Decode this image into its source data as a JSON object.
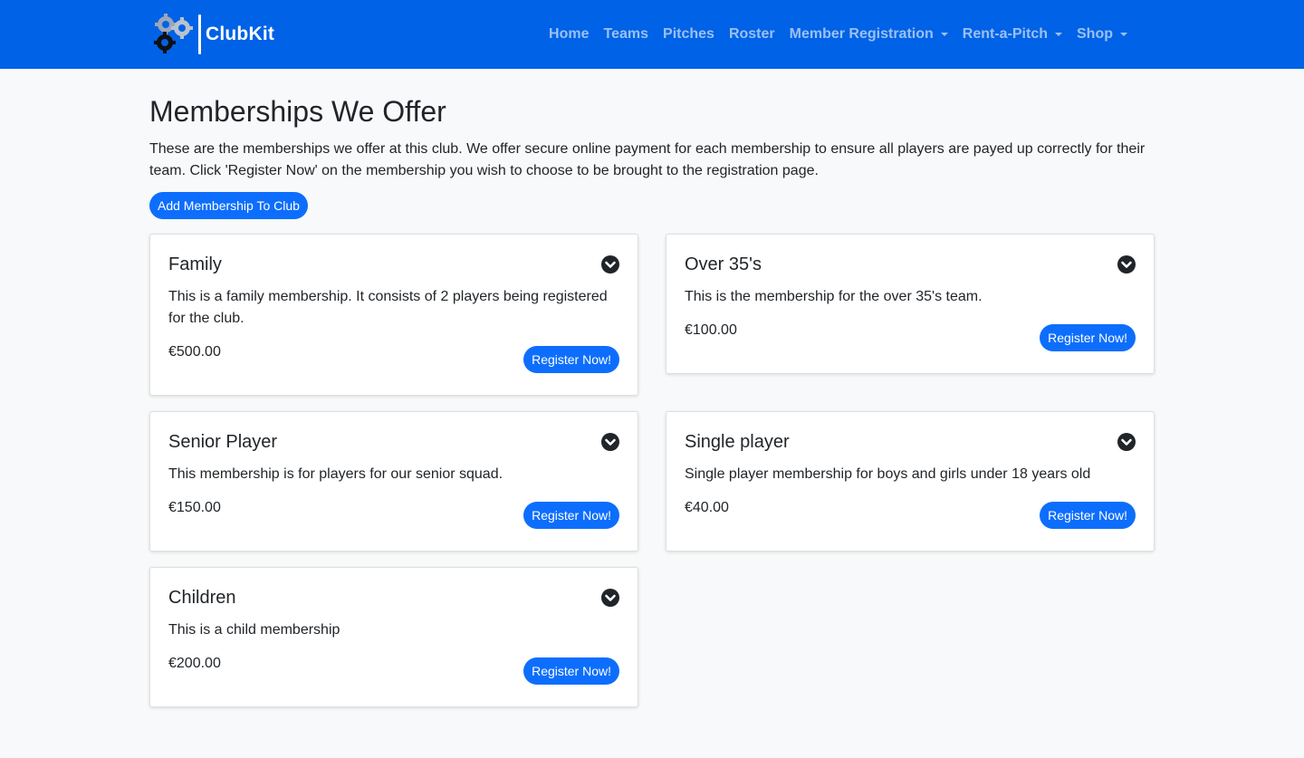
{
  "brand": {
    "name": "ClubKit"
  },
  "nav": {
    "items": [
      {
        "label": "Home",
        "dropdown": false
      },
      {
        "label": "Teams",
        "dropdown": false
      },
      {
        "label": "Pitches",
        "dropdown": false
      },
      {
        "label": "Roster",
        "dropdown": false
      },
      {
        "label": "Member Registration",
        "dropdown": true
      },
      {
        "label": "Rent-a-Pitch",
        "dropdown": true
      },
      {
        "label": "Shop",
        "dropdown": true
      }
    ]
  },
  "page": {
    "title": "Memberships We Offer",
    "intro": "These are the memberships we offer at this club. We offer secure online payment for each membership to ensure all players are payed up correctly for their team. Click 'Register Now' on the membership you wish to choose to be brought to the registration page.",
    "add_button": "Add Membership To Club"
  },
  "memberships": [
    {
      "name": "Family",
      "description": "This is a family membership. It consists of 2 players being registered for the club.",
      "price": "€500.00",
      "button": "Register Now!",
      "icon": "chevron-down-circle-icon"
    },
    {
      "name": "Over 35's",
      "description": "This is the membership for the over 35's team.",
      "price": "€100.00",
      "button": "Register Now!",
      "icon": "chevron-down-circle-icon"
    },
    {
      "name": "Senior Player",
      "description": "This membership is for players for our senior squad.",
      "price": "€150.00",
      "button": "Register Now!",
      "icon": "chevron-down-circle-icon"
    },
    {
      "name": "Single player",
      "description": "Single player membership for boys and girls under 18 years old",
      "price": "€40.00",
      "button": "Register Now!",
      "icon": "chevron-down-circle-icon"
    },
    {
      "name": "Children",
      "description": "This is a child membership",
      "price": "€200.00",
      "button": "Register Now!",
      "icon": "chevron-down-circle-icon"
    }
  ],
  "colors": {
    "navbar": "#0062e6",
    "primary_button": "#0d6efd",
    "page_background": "#f8f9fa"
  }
}
